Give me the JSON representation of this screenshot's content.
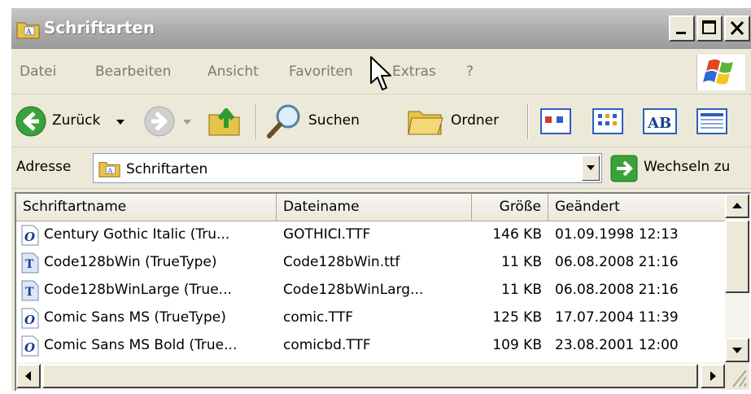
{
  "window": {
    "title": "Schriftarten"
  },
  "menu": {
    "items": [
      "Datei",
      "Bearbeiten",
      "Ansicht",
      "Favoriten",
      "Extras",
      "?"
    ]
  },
  "toolbar": {
    "back_label": "Zurück",
    "search_label": "Suchen",
    "folders_label": "Ordner"
  },
  "address": {
    "label": "Adresse",
    "value": "Schriftarten",
    "go_label": "Wechseln zu"
  },
  "list": {
    "columns": [
      "Schriftartname",
      "Dateiname",
      "Größe",
      "Geändert"
    ],
    "rows": [
      {
        "name": "Century Gothic Italic (Tru...",
        "file": "GOTHICI.TTF",
        "size": "146 KB",
        "modified": "01.09.1998 12:13",
        "type": "opentype"
      },
      {
        "name": "Code128bWin (TrueType)",
        "file": "Code128bWin.ttf",
        "size": "11 KB",
        "modified": "06.08.2008 21:16",
        "type": "truetype"
      },
      {
        "name": "Code128bWinLarge (True...",
        "file": "Code128bWinLarg...",
        "size": "11 KB",
        "modified": "06.08.2008 21:16",
        "type": "truetype"
      },
      {
        "name": "Comic Sans MS (TrueType)",
        "file": "comic.TTF",
        "size": "125 KB",
        "modified": "17.07.2004 11:39",
        "type": "opentype"
      },
      {
        "name": "Comic Sans MS Bold (True...",
        "file": "comicbd.TTF",
        "size": "109 KB",
        "modified": "23.08.2001 12:00",
        "type": "opentype"
      }
    ]
  },
  "colors": {
    "titlebar": "#a9a9a9",
    "chrome": "#ece9d8",
    "back_arrow": "#3aa23a",
    "folder": "#e8c34a"
  }
}
